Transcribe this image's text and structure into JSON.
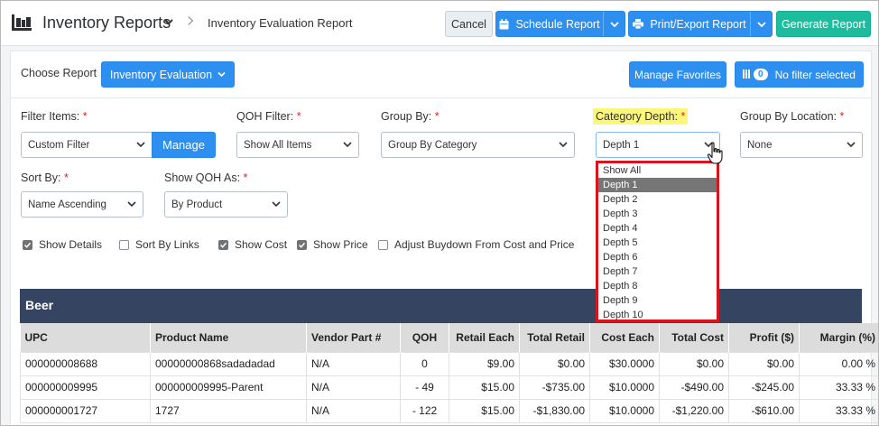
{
  "header": {
    "app_title": "Inventory Reports",
    "breadcrumb": "Inventory Evaluation Report",
    "cancel_label": "Cancel",
    "schedule_label": "Schedule Report",
    "print_label": "Print/Export Report",
    "generate_label": "Generate Report"
  },
  "choose": {
    "label": "Choose Report",
    "report_button": "Inventory Evaluation",
    "manage_favorites": "Manage Favorites",
    "filter_count": "0",
    "filter_text": "No filter selected"
  },
  "filters": {
    "filter_items": {
      "label": "Filter Items:",
      "value": "Custom Filter",
      "manage": "Manage"
    },
    "qoh_filter": {
      "label": "QOH Filter:",
      "value": "Show All Items"
    },
    "group_by": {
      "label": "Group By:",
      "value": "Group By Category"
    },
    "category_depth": {
      "label": "Category Depth:",
      "value": "Depth 1"
    },
    "group_by_location": {
      "label": "Group By Location:",
      "value": "None"
    },
    "sort_by": {
      "label": "Sort By:",
      "value": "Name Ascending"
    },
    "show_qoh_as": {
      "label": "Show QOH As:",
      "value": "By Product"
    },
    "required_mark": "*"
  },
  "checkboxes": [
    {
      "label": "Show Details",
      "checked": true
    },
    {
      "label": "Sort By Links",
      "checked": false
    },
    {
      "label": "Show Cost",
      "checked": true
    },
    {
      "label": "Show Price",
      "checked": true
    },
    {
      "label": "Adjust Buydown From Cost and Price",
      "checked": false
    }
  ],
  "depth_options": [
    "Show All",
    "Depth 1",
    "Depth 2",
    "Depth 3",
    "Depth 4",
    "Depth 5",
    "Depth 6",
    "Depth 7",
    "Depth 8",
    "Depth 9",
    "Depth 10"
  ],
  "table": {
    "group": "Beer",
    "columns": [
      "UPC",
      "Product Name",
      "Vendor Part #",
      "QOH",
      "Retail Each",
      "Total Retail",
      "Cost Each",
      "Total Cost",
      "Profit ($)",
      "Margin (%)"
    ],
    "rows": [
      [
        "000000008688",
        "00000000868sadadadad",
        "N/A",
        "0",
        "$9.00",
        "$0.00",
        "$30.0000",
        "$0.00",
        "$0.00",
        "0.00 %"
      ],
      [
        "000000009995",
        "000000009995-Parent",
        "N/A",
        "- 49",
        "$15.00",
        "-$735.00",
        "$10.0000",
        "-$490.00",
        "-$245.00",
        "33.33 %"
      ],
      [
        "000000001727",
        "1727",
        "N/A",
        "- 122",
        "$15.00",
        "-$1,830.00",
        "$10.0000",
        "-$1,220.00",
        "-$610.00",
        "33.33 %"
      ]
    ]
  }
}
